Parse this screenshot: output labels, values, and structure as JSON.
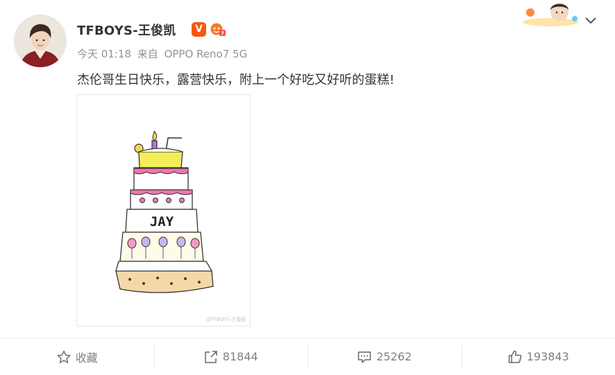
{
  "post": {
    "username": "TFBOYS-王俊凯",
    "badge_v": "V",
    "time": "今天 01:18",
    "source_prefix": "来自",
    "source_device": "OPPO Reno7 5G",
    "text": "杰伦哥生日快乐，露营快乐，附上一个好吃又好听的蛋糕!",
    "image_watermark": "@TFBOYS-王俊凯",
    "cake_text": "JAY"
  },
  "actions": {
    "favorite_label": "收藏",
    "repost_count": "81844",
    "comment_count": "25262",
    "like_count": "193843"
  },
  "icons": {
    "favorite": "star-outline-icon",
    "repost": "share-arrow-icon",
    "comment": "comment-icon",
    "like": "thumbs-up-icon",
    "more": "chevron-down-icon"
  },
  "colors": {
    "accent_orange": "#f55a0c",
    "text_primary": "#333333",
    "text_secondary": "#939393",
    "action_gray": "#808080"
  }
}
